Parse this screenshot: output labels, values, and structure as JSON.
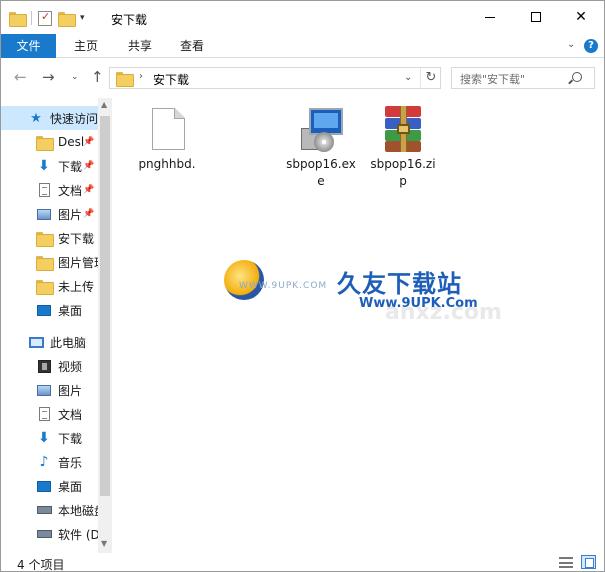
{
  "window": {
    "title": "安下载",
    "qat_dropdown": "▾",
    "min_label": "",
    "max_label": "",
    "close_label": "✕"
  },
  "ribbon": {
    "tabs": [
      {
        "label": "文件"
      },
      {
        "label": "主页"
      },
      {
        "label": "共享"
      },
      {
        "label": "查看"
      }
    ],
    "expand_glyph": "⌄",
    "help_glyph": "?"
  },
  "nav": {
    "back_glyph": "←",
    "forward_glyph": "→",
    "recent_glyph": "⌄",
    "up_glyph": "↑",
    "address_sep": "›",
    "address": "安下载",
    "address_dd": "⌄",
    "refresh_glyph": "↻",
    "search_placeholder": "搜索\"安下载\""
  },
  "sidebar": {
    "items": [
      {
        "label": "快速访问",
        "icon": "star-icon"
      },
      {
        "label": "Desl",
        "icon": "folder-icon",
        "pinned": true
      },
      {
        "label": "下载",
        "icon": "download-arrow-icon",
        "pinned": true
      },
      {
        "label": "文档",
        "icon": "document-icon",
        "pinned": true
      },
      {
        "label": "图片",
        "icon": "picture-icon",
        "pinned": true
      },
      {
        "label": "安下载",
        "icon": "folder-icon"
      },
      {
        "label": "图片管理",
        "icon": "folder-icon"
      },
      {
        "label": "未上传",
        "icon": "folder-icon"
      },
      {
        "label": "桌面",
        "icon": "desktop-icon"
      },
      {
        "label": "此电脑",
        "icon": "computer-icon"
      },
      {
        "label": "视频",
        "icon": "video-icon"
      },
      {
        "label": "图片",
        "icon": "picture-icon"
      },
      {
        "label": "文档",
        "icon": "document-icon"
      },
      {
        "label": "下载",
        "icon": "download-arrow-icon"
      },
      {
        "label": "音乐",
        "icon": "music-note-icon"
      },
      {
        "label": "桌面",
        "icon": "desktop-icon"
      },
      {
        "label": "本地磁盘",
        "icon": "drive-icon"
      },
      {
        "label": "软件 (D",
        "icon": "drive-icon"
      }
    ],
    "pin_glyph": "📌"
  },
  "files": [
    {
      "name": "pnghhbd.",
      "type": "blank-file"
    },
    {
      "name": "sbpop16.exe",
      "type": "exe"
    },
    {
      "name": "sbpop16.zip",
      "type": "zip"
    }
  ],
  "watermark": {
    "brand": "久友下载站",
    "url": "Www.9UPK.Com",
    "small": "WWW.9UPK.COM",
    "ghost": "anxz.com"
  },
  "status": {
    "text": "4 个项目"
  },
  "colors": {
    "accent": "#1979ca",
    "selection": "#cce8ff",
    "folder": "#f3cf62"
  }
}
